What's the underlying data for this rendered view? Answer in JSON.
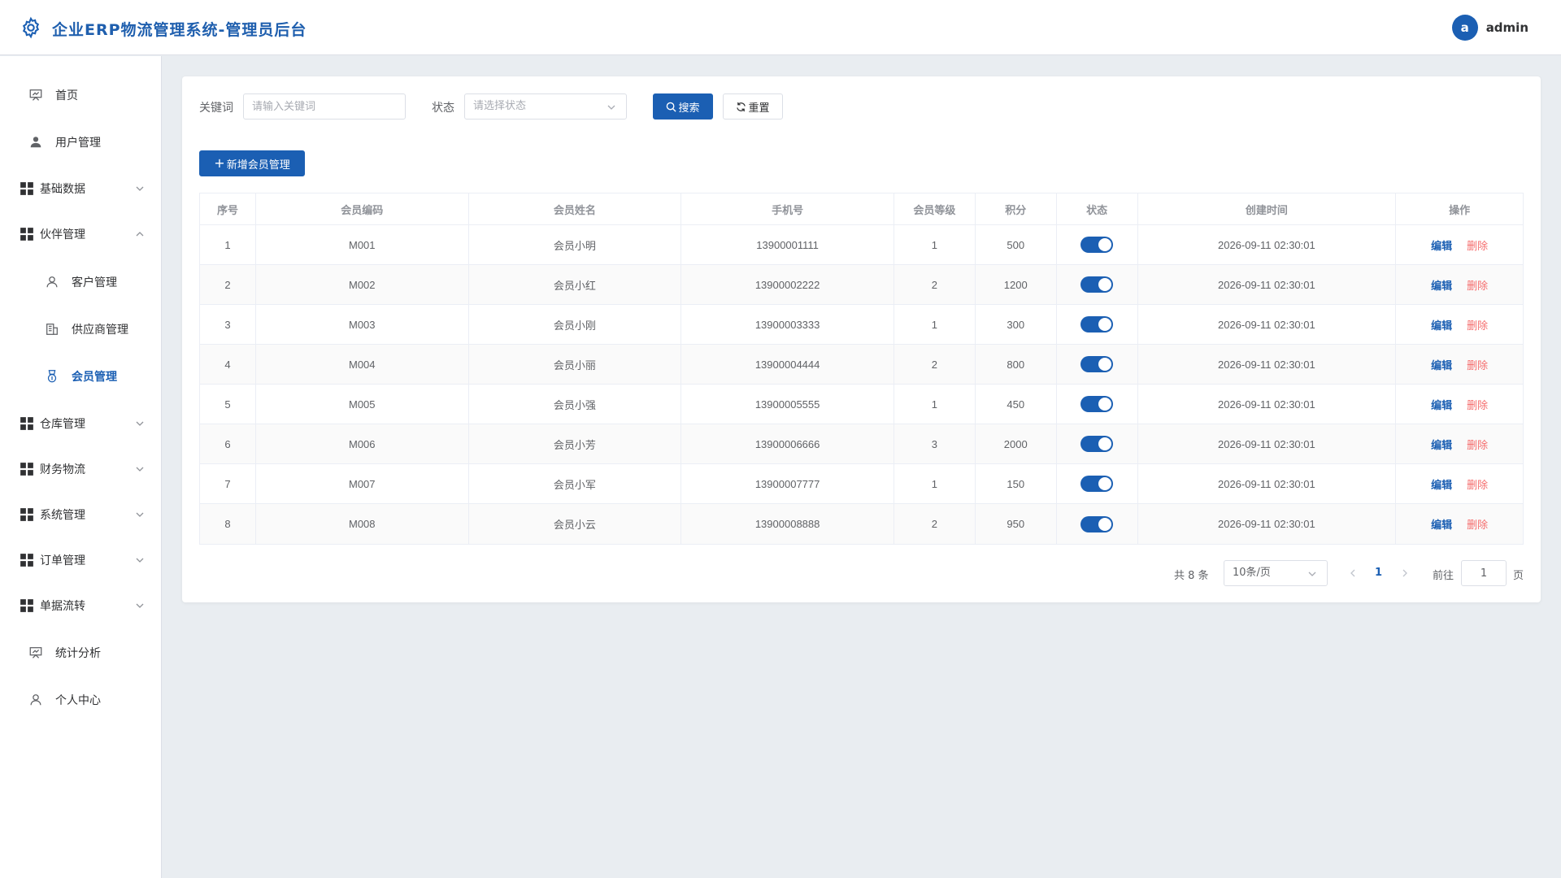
{
  "header": {
    "title": "企业ERP物流管理系统-管理员后台",
    "avatar_letter": "a",
    "username": "admin"
  },
  "sidebar": {
    "items": [
      {
        "label": "首页",
        "icon": "presentation-icon"
      },
      {
        "label": "用户管理",
        "icon": "user-filled-icon"
      },
      {
        "label": "基础数据",
        "icon": "grid-icon",
        "expandable": true
      },
      {
        "label": "伙伴管理",
        "icon": "grid-icon",
        "expandable": true,
        "expanded": true
      },
      {
        "label": "客户管理",
        "icon": "user-outline-icon",
        "sub": true
      },
      {
        "label": "供应商管理",
        "icon": "building-icon",
        "sub": true
      },
      {
        "label": "会员管理",
        "icon": "medal-icon",
        "sub": true,
        "active": true
      },
      {
        "label": "仓库管理",
        "icon": "grid-icon",
        "expandable": true
      },
      {
        "label": "财务物流",
        "icon": "grid-icon",
        "expandable": true
      },
      {
        "label": "系统管理",
        "icon": "grid-icon",
        "expandable": true
      },
      {
        "label": "订单管理",
        "icon": "grid-icon",
        "expandable": true
      },
      {
        "label": "单据流转",
        "icon": "grid-icon",
        "expandable": true
      },
      {
        "label": "统计分析",
        "icon": "presentation-icon"
      },
      {
        "label": "个人中心",
        "icon": "user-outline-icon"
      }
    ]
  },
  "filters": {
    "keyword_label": "关键词",
    "keyword_placeholder": "请输入关键词",
    "status_label": "状态",
    "status_placeholder": "请选择状态",
    "search_label": "搜索",
    "reset_label": "重置"
  },
  "add_button_label": "新增会员管理",
  "table": {
    "columns": [
      "序号",
      "会员编码",
      "会员姓名",
      "手机号",
      "会员等级",
      "积分",
      "状态",
      "创建时间",
      "操作"
    ],
    "edit_label": "编辑",
    "delete_label": "删除",
    "rows": [
      {
        "idx": "1",
        "code": "M001",
        "name": "会员小明",
        "phone": "13900001111",
        "level": "1",
        "points": "500",
        "status_on": true,
        "created": "2026-09-11 02:30:01"
      },
      {
        "idx": "2",
        "code": "M002",
        "name": "会员小红",
        "phone": "13900002222",
        "level": "2",
        "points": "1200",
        "status_on": true,
        "created": "2026-09-11 02:30:01"
      },
      {
        "idx": "3",
        "code": "M003",
        "name": "会员小刚",
        "phone": "13900003333",
        "level": "1",
        "points": "300",
        "status_on": true,
        "created": "2026-09-11 02:30:01"
      },
      {
        "idx": "4",
        "code": "M004",
        "name": "会员小丽",
        "phone": "13900004444",
        "level": "2",
        "points": "800",
        "status_on": true,
        "created": "2026-09-11 02:30:01"
      },
      {
        "idx": "5",
        "code": "M005",
        "name": "会员小强",
        "phone": "13900005555",
        "level": "1",
        "points": "450",
        "status_on": true,
        "created": "2026-09-11 02:30:01"
      },
      {
        "idx": "6",
        "code": "M006",
        "name": "会员小芳",
        "phone": "13900006666",
        "level": "3",
        "points": "2000",
        "status_on": true,
        "created": "2026-09-11 02:30:01"
      },
      {
        "idx": "7",
        "code": "M007",
        "name": "会员小军",
        "phone": "13900007777",
        "level": "1",
        "points": "150",
        "status_on": true,
        "created": "2026-09-11 02:30:01"
      },
      {
        "idx": "8",
        "code": "M008",
        "name": "会员小云",
        "phone": "13900008888",
        "level": "2",
        "points": "950",
        "status_on": true,
        "created": "2026-09-11 02:30:01"
      }
    ]
  },
  "pagination": {
    "total_text": "共 8 条",
    "page_size": "10条/页",
    "current_page": "1",
    "goto_prefix": "前往",
    "goto_value": "1",
    "goto_suffix": "页"
  },
  "colors": {
    "primary": "#1b5fb3",
    "danger": "#f56c6c",
    "background": "#e9edf1"
  }
}
